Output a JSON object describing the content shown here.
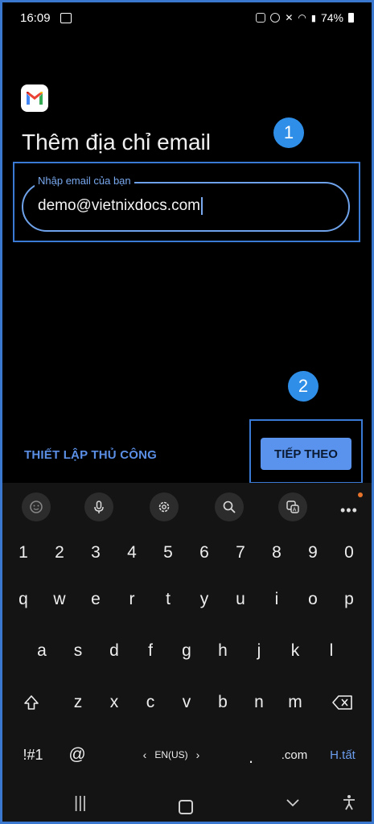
{
  "status_bar": {
    "time": "16:09",
    "battery": "74%"
  },
  "title": "Thêm địa chỉ email",
  "email_field": {
    "label": "Nhập email của bạn",
    "value": "demo@vietnixdocs.com"
  },
  "annotations": {
    "step1": "1",
    "step2": "2"
  },
  "manual_setup_label": "THIẾT LẬP THỦ CÔNG",
  "next_label": "TIẾP THEO",
  "keyboard": {
    "toolbar_icons": [
      "emoji-icon",
      "mic-icon",
      "settings-icon",
      "search-icon",
      "translate-icon",
      "more-icon"
    ],
    "row_numbers": [
      "1",
      "2",
      "3",
      "4",
      "5",
      "6",
      "7",
      "8",
      "9",
      "0"
    ],
    "row_q": [
      "q",
      "w",
      "e",
      "r",
      "t",
      "y",
      "u",
      "i",
      "o",
      "p"
    ],
    "row_a": [
      "a",
      "s",
      "d",
      "f",
      "g",
      "h",
      "j",
      "k",
      "l"
    ],
    "row_z": [
      "z",
      "x",
      "c",
      "v",
      "b",
      "n",
      "m"
    ],
    "symbols_label": "!#1",
    "at_label": "@",
    "language_label": "EN(US)",
    "period_label": ".",
    "dotcom_label": ".com",
    "done_label": "H.tất"
  },
  "colors": {
    "accent": "#5a93ee",
    "badge": "#2f8fe8",
    "highlight": "#3b7ad4"
  }
}
